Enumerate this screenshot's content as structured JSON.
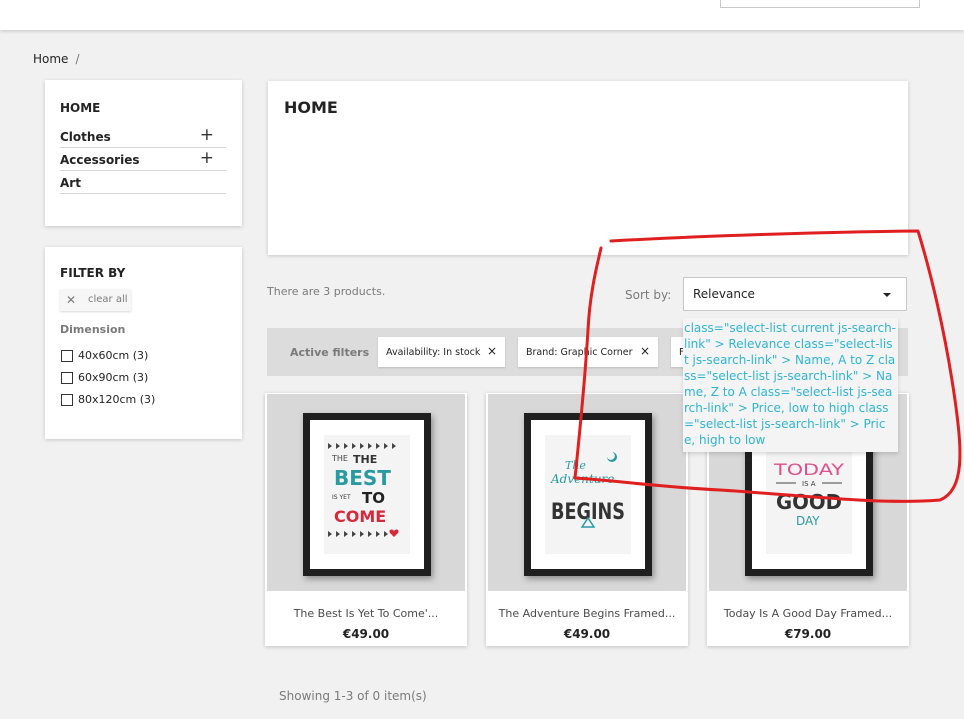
{
  "breadcrumb": {
    "home": "Home",
    "separator": "/"
  },
  "categories": {
    "title": "HOME",
    "items": [
      {
        "label": "Clothes",
        "toggle": "+"
      },
      {
        "label": "Accessories",
        "toggle": "+"
      },
      {
        "label": "Art",
        "toggle": ""
      }
    ]
  },
  "filters": {
    "title": "FILTER BY",
    "clear_all": "clear all",
    "facet_title": "Dimension",
    "options": [
      "40x60cm (3)",
      "60x90cm (3)",
      "80x120cm (3)"
    ]
  },
  "main": {
    "title": "HOME",
    "products_count": "There are 3 products.",
    "sort_label": "Sort by:",
    "sort_selected": "Relevance",
    "sort_dropdown_text": "class=\"select-list current js-search-link\" > Relevance class=\"select-list js-search-link\" > Name, A to Z class=\"select-list js-search-link\" > Name, Z to A class=\"select-list js-search-link\" > Price, low to high class=\"select-list js-search-link\" > Price, high to low",
    "active_filters_label": "Active filters",
    "active_filters": [
      {
        "label": "Availability: In stock",
        "remove": "×"
      },
      {
        "label": "Brand: Graphic Corner",
        "remove": "×"
      },
      {
        "label": "F",
        "remove": ""
      }
    ]
  },
  "products": [
    {
      "name": "The Best Is Yet To Come'...",
      "price": "€49.00",
      "art": [
        "THE",
        "BEST",
        "IS YET",
        "TO",
        "COME"
      ]
    },
    {
      "name": "The Adventure Begins Framed...",
      "price": "€49.00",
      "art": [
        "The",
        "Adventure",
        "BEGINS"
      ]
    },
    {
      "name": "Today Is A Good Day Framed...",
      "price": "€79.00",
      "art": [
        "TODAY",
        "IS A",
        "GOOD",
        "DAY"
      ]
    }
  ],
  "pagination": {
    "showing": "Showing 1-3 of 0 item(s)"
  },
  "colors": {
    "link": "#2fb5d2",
    "annotation": "#e02020",
    "accent_red": "#d8283b",
    "teal": "#2a9aa1"
  }
}
